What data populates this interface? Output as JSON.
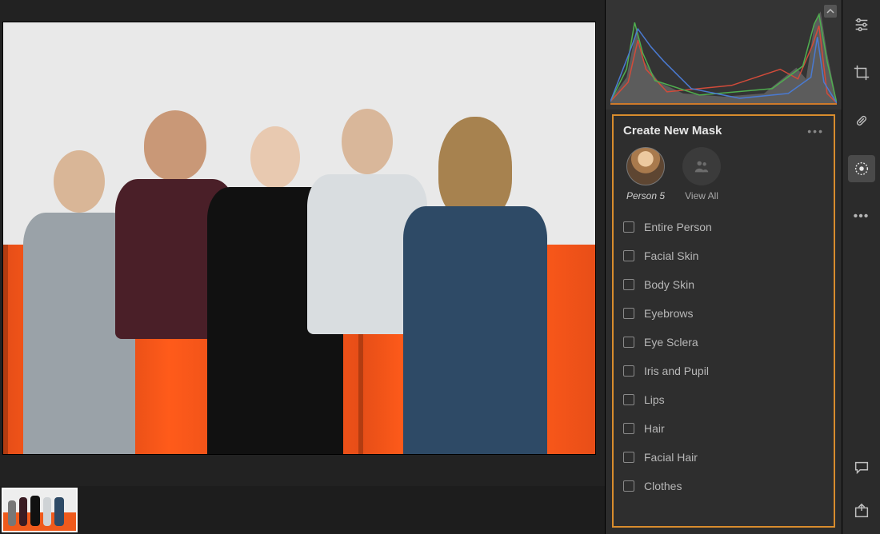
{
  "panel": {
    "title": "Create New Mask",
    "selected_person_label": "Person 5",
    "view_all_label": "View All",
    "options": [
      "Entire Person",
      "Facial Skin",
      "Body Skin",
      "Eyebrows",
      "Eye Sclera",
      "Iris and Pupil",
      "Lips",
      "Hair",
      "Facial Hair",
      "Clothes"
    ]
  },
  "tools": {
    "edit": "edit-sliders",
    "crop": "crop",
    "heal": "healing",
    "mask": "masking",
    "more": "more",
    "comment": "comment",
    "export": "export"
  }
}
